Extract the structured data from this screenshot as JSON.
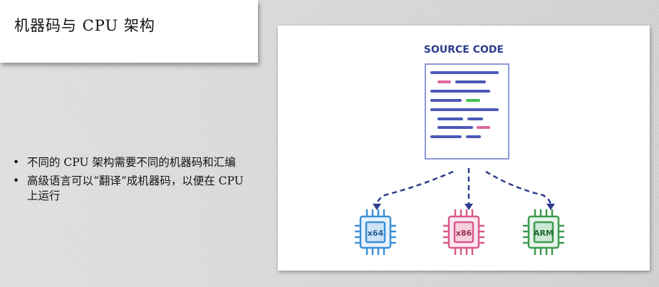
{
  "slide": {
    "title": "机器码与 CPU 架构",
    "bullets": [
      {
        "text": "不同的 CPU 架构需要不同的机器码和汇编"
      },
      {
        "text": "高级语言可以“翻译”成机器码，以便在 CPU 上运行"
      }
    ]
  },
  "diagram": {
    "source_label": "SOURCE CODE",
    "chips": [
      {
        "label": "x64",
        "color": "#3a8fd6"
      },
      {
        "label": "x86",
        "color": "#d75a8a"
      },
      {
        "label": "ARM",
        "color": "#3a9a4f"
      }
    ],
    "colors": {
      "code_line": "#4b58b8",
      "accent_pink": "#e0679a",
      "accent_green": "#3fbf4f",
      "arrow": "#2d3d8f"
    }
  }
}
